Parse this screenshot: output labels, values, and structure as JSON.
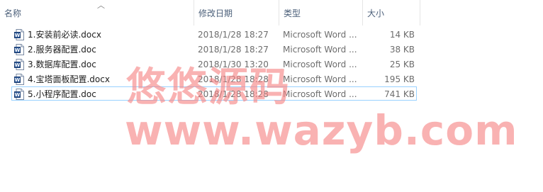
{
  "columns": {
    "name": "名称",
    "date": "修改日期",
    "type": "类型",
    "size": "大小"
  },
  "sort_icon": "chevron-up-icon",
  "file_icon": "word-document-icon",
  "files": [
    {
      "name": "1.安装前必读.docx",
      "date": "2018/1/28 18:27",
      "type": "Microsoft Word ...",
      "size": "14 KB"
    },
    {
      "name": "2.服务器配置.doc",
      "date": "2018/1/28 18:27",
      "type": "Microsoft Word ...",
      "size": "38 KB"
    },
    {
      "name": "3.数据库配置.doc",
      "date": "2018/1/30 13:20",
      "type": "Microsoft Word ...",
      "size": "25 KB"
    },
    {
      "name": "4.宝塔面板配置.docx",
      "date": "2018/1/28 18:28",
      "type": "Microsoft Word ...",
      "size": "195 KB"
    },
    {
      "name": "5.小程序配置.doc",
      "date": "2018/1/28 18:28",
      "type": "Microsoft Word ...",
      "size": "741 KB"
    }
  ],
  "watermark": {
    "cn": "悠悠源码",
    "url": "www.wazyb.com",
    "color": "#f68282"
  }
}
